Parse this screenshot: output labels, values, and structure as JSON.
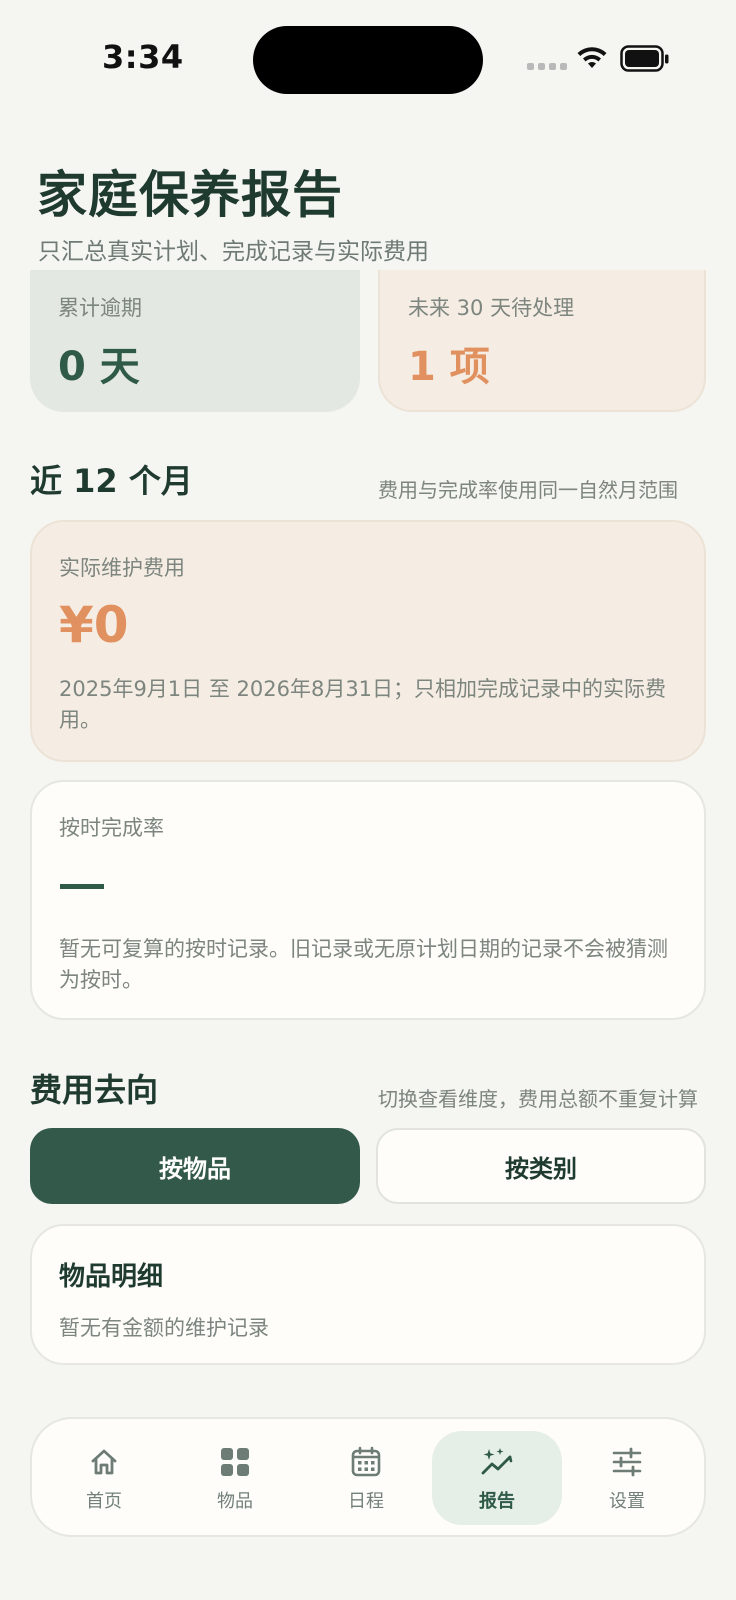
{
  "status_bar": {
    "time": "3:34"
  },
  "header": {
    "title": "家庭保养报告",
    "subtitle": "只汇总真实计划、完成记录与实际费用"
  },
  "stats": [
    {
      "label": "累计逾期",
      "value": "0 天"
    },
    {
      "label": "未来 30 天待处理",
      "value": "1 项"
    }
  ],
  "recent": {
    "title": "近 12 个月",
    "note": "费用与完成率使用同一自然月范围",
    "cost_card": {
      "label": "实际维护费用",
      "value": "¥0",
      "description": "2025年9月1日 至 2026年8月31日；只相加完成记录中的实际费用。"
    },
    "rate_card": {
      "label": "按时完成率",
      "value": "—",
      "description": "暂无可复算的按时记录。旧记录或无原计划日期的记录不会被猜测为按时。"
    }
  },
  "spending": {
    "title": "费用去向",
    "note": "切换查看维度，费用总额不重复计算",
    "toggle_by_item": "按物品",
    "toggle_by_category": "按类别",
    "active_toggle": "按物品",
    "detail_title": "物品明细",
    "detail_empty": "暂无有金额的维护记录"
  },
  "tabbar": {
    "items": [
      {
        "label": "首页",
        "icon": "home-icon"
      },
      {
        "label": "物品",
        "icon": "grid-icon"
      },
      {
        "label": "日程",
        "icon": "calendar-icon"
      },
      {
        "label": "报告",
        "icon": "sparkle-chart-icon"
      },
      {
        "label": "设置",
        "icon": "sliders-icon"
      }
    ],
    "selected": "报告"
  },
  "colors": {
    "accent_green": "#33594a",
    "accent_orange": "#e1915f",
    "background": "#f5f5f1"
  }
}
